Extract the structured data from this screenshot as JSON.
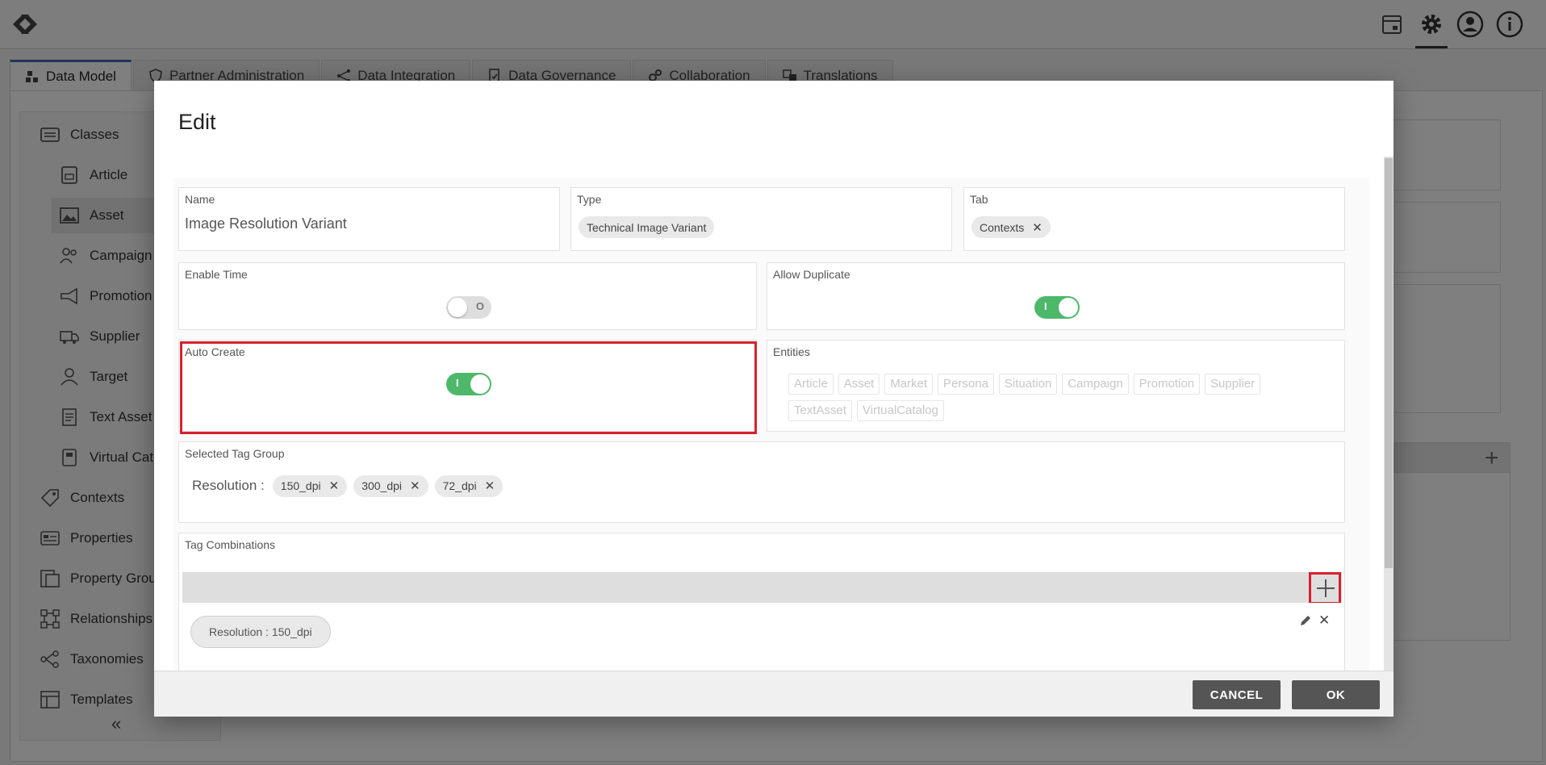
{
  "tabs": [
    {
      "label": "Data Model",
      "icon": "cubes-icon"
    },
    {
      "label": "Partner Administration",
      "icon": "shield-icon"
    },
    {
      "label": "Data Integration",
      "icon": "network-icon"
    },
    {
      "label": "Data Governance",
      "icon": "document-check-icon"
    },
    {
      "label": "Collaboration",
      "icon": "gears-icon"
    },
    {
      "label": "Translations",
      "icon": "translate-icon"
    }
  ],
  "sidebar": {
    "items": [
      {
        "label": "Classes",
        "icon": "list-icon"
      },
      {
        "label": "Article",
        "icon": "article-icon"
      },
      {
        "label": "Asset",
        "icon": "image-icon"
      },
      {
        "label": "Campaign",
        "icon": "people-icon"
      },
      {
        "label": "Promotion",
        "icon": "megaphone-icon"
      },
      {
        "label": "Supplier",
        "icon": "truck-icon"
      },
      {
        "label": "Target",
        "icon": "user-icon"
      },
      {
        "label": "Text Asset",
        "icon": "text-doc-icon"
      },
      {
        "label": "Virtual Cat",
        "icon": "catalog-icon"
      },
      {
        "label": "Contexts",
        "icon": "tag-icon"
      },
      {
        "label": "Properties",
        "icon": "properties-icon"
      },
      {
        "label": "Property Grou",
        "icon": "property-group-icon"
      },
      {
        "label": "Relationships",
        "icon": "relationships-icon"
      },
      {
        "label": "Taxonomies",
        "icon": "taxonomy-icon"
      },
      {
        "label": "Templates",
        "icon": "template-icon"
      }
    ]
  },
  "modal": {
    "title": "Edit",
    "name": {
      "label": "Name",
      "value": "Image Resolution Variant"
    },
    "type": {
      "label": "Type",
      "chip": "Technical Image Variant"
    },
    "tab": {
      "label": "Tab",
      "chip": "Contexts"
    },
    "enable_time": {
      "label": "Enable Time",
      "state": "O"
    },
    "allow_duplicate": {
      "label": "Allow Duplicate",
      "state": "I"
    },
    "auto_create": {
      "label": "Auto Create",
      "state": "I"
    },
    "entities": {
      "label": "Entities",
      "items": [
        "Article",
        "Asset",
        "Market",
        "Persona",
        "Situation",
        "Campaign",
        "Promotion",
        "Supplier",
        "TextAsset",
        "VirtualCatalog"
      ]
    },
    "selected_tag_group": {
      "label": "Selected Tag Group",
      "group": "Resolution :",
      "tags": [
        "150_dpi",
        "300_dpi",
        "72_dpi"
      ]
    },
    "tag_combinations": {
      "label": "Tag Combinations",
      "rows": [
        {
          "key": "Resolution :",
          "value": "150_dpi"
        }
      ]
    },
    "cancel_label": "CANCEL",
    "ok_label": "OK"
  }
}
